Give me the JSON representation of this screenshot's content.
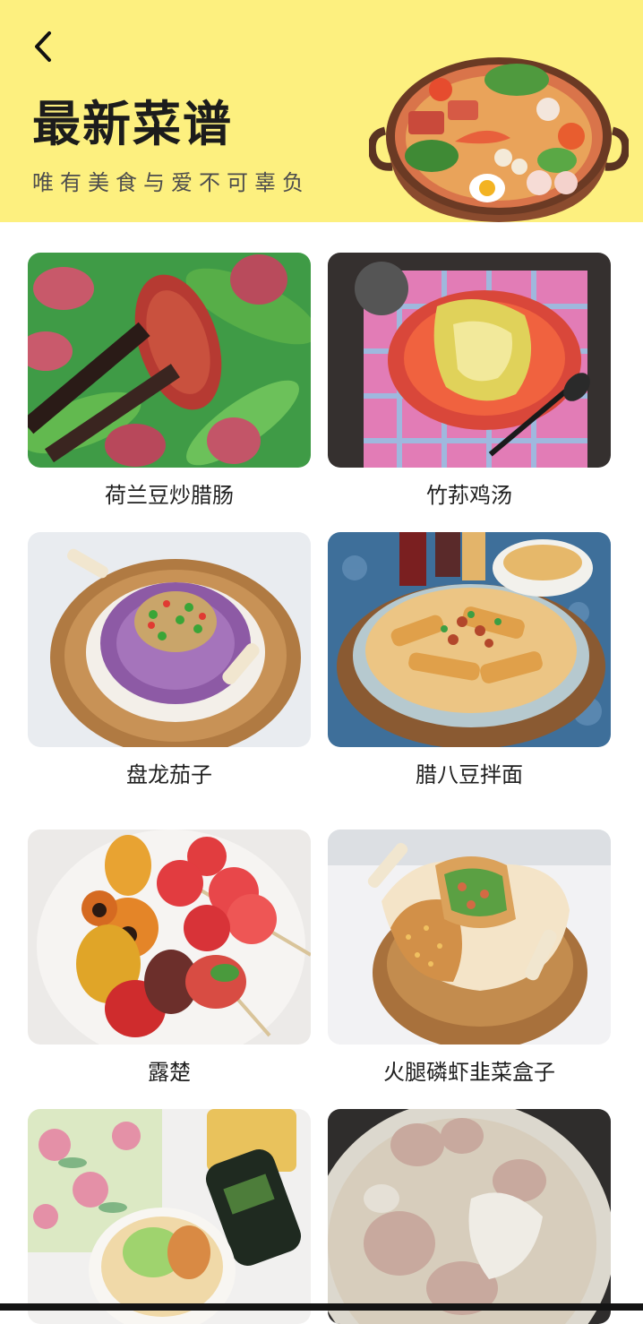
{
  "header": {
    "back_icon": "chevron-left-icon",
    "title": "最新菜谱",
    "subtitle": "唯有美食与爱不可辜负",
    "background_color": "#fdf07f",
    "illustration": "hotpot-illustration"
  },
  "recipes": [
    {
      "name": "荷兰豆炒腊肠",
      "image": "snow-peas-sausage-photo"
    },
    {
      "name": "竹荪鸡汤",
      "image": "bamboo-fungus-chicken-soup-photo"
    },
    {
      "name": "盘龙茄子",
      "image": "coiled-dragon-eggplant-photo"
    },
    {
      "name": "腊八豆拌面",
      "image": "laba-bean-noodles-photo"
    },
    {
      "name": "露楚",
      "image": "fruit-skewers-photo"
    },
    {
      "name": "火腿磷虾韭菜盒子",
      "image": "chive-box-photo"
    },
    {
      "name": "",
      "image": "cold-noodles-photo"
    },
    {
      "name": "",
      "image": "pork-rib-soup-photo"
    }
  ]
}
